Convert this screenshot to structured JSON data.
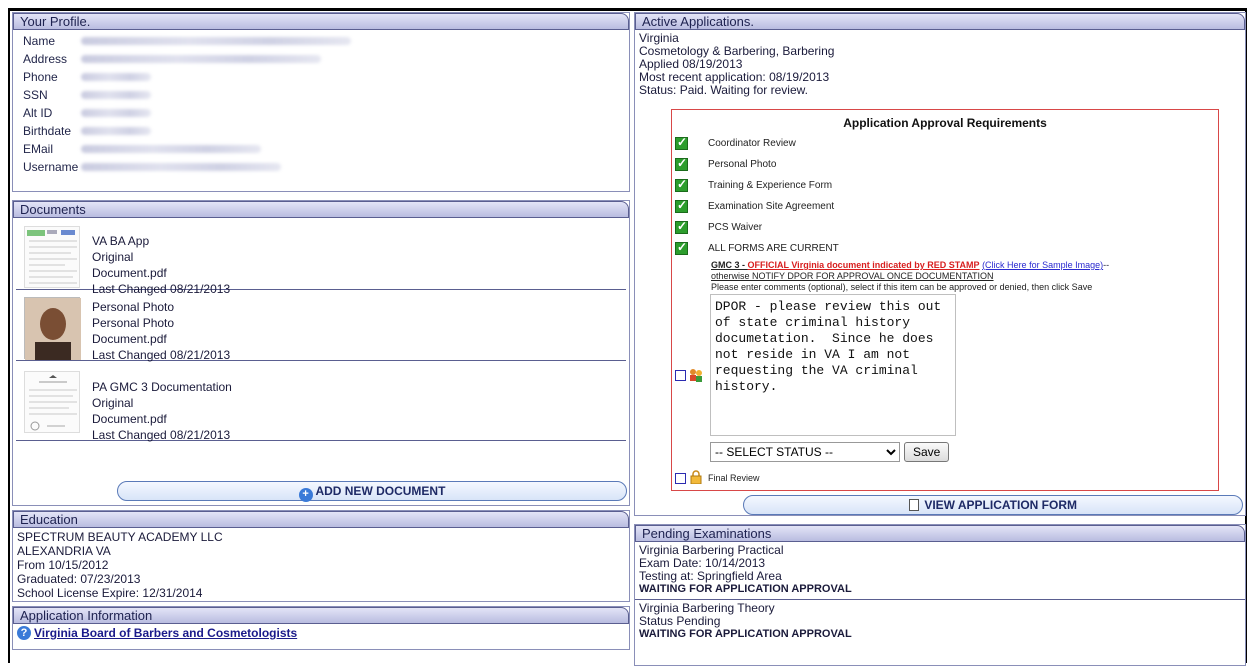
{
  "profile": {
    "title": "Your Profile.",
    "fields": [
      {
        "label": "Name"
      },
      {
        "label": "Address"
      },
      {
        "label": "Phone"
      },
      {
        "label": "SSN"
      },
      {
        "label": "Alt ID"
      },
      {
        "label": "Birthdate"
      },
      {
        "label": "EMail"
      },
      {
        "label": "Username"
      }
    ]
  },
  "documents": {
    "title": "Documents",
    "items": [
      {
        "name": "VA BA App",
        "type": "Original",
        "file": "Document.pdf",
        "changed": "Last Changed 08/21/2013"
      },
      {
        "name": "Personal Photo",
        "type": "Personal Photo",
        "file": "Document.pdf",
        "changed": "Last Changed 08/21/2013"
      },
      {
        "name": "PA GMC 3 Documentation",
        "type": "Original",
        "file": "Document.pdf",
        "changed": "Last Changed 08/21/2013"
      }
    ],
    "add_button": "ADD NEW DOCUMENT"
  },
  "education": {
    "title": "Education",
    "lines": [
      "SPECTRUM BEAUTY ACADEMY LLC",
      "ALEXANDRIA VA",
      "From 10/15/2012",
      "Graduated: 07/23/2013",
      "School License Expire: 12/31/2014"
    ]
  },
  "app_info": {
    "title": "Application Information",
    "link": "Virginia Board of Barbers and Cosmetologists"
  },
  "active": {
    "title": "Active Applications.",
    "lines": [
      "Virginia",
      "Cosmetology & Barbering, Barbering",
      "Applied 08/19/2013",
      "Most recent application: 08/19/2013",
      "Status: Paid. Waiting for review."
    ],
    "requirements": {
      "title": "Application Approval Requirements",
      "items": [
        "Coordinator Review",
        "Personal Photo",
        "Training & Experience Form",
        "Examination Site Agreement",
        "PCS Waiver",
        "ALL FORMS ARE CURRENT"
      ],
      "gmc_prefix": "GMC 3 - ",
      "gmc_red": "OFFICIAL Virginia document indicated by RED STAMP",
      "gmc_link": "(Click Here for Sample Image)",
      "gmc_suffix": "--",
      "gmc_line2": "otherwise NOTIFY DPOR FOR APPROVAL ONCE DOCUMENTATION",
      "instructions": "Please enter comments (optional), select if this item can be approved or denied, then click Save",
      "comment": "DPOR - please review this out\nof state criminal history\ndocumetation.  Since he does\nnot reside in VA I am not\nrequesting the VA criminal\nhistory.",
      "status_select": "-- SELECT STATUS --",
      "save": "Save",
      "final_review": "Final Review"
    },
    "view_button": "VIEW APPLICATION FORM"
  },
  "pending": {
    "title": "Pending Examinations",
    "exams": [
      {
        "name": "Virginia Barbering Practical",
        "line2": "Exam Date: 10/14/2013",
        "line3": "Testing at: Springfield Area",
        "status": "WAITING FOR APPLICATION APPROVAL"
      },
      {
        "name": "Virginia Barbering Theory",
        "line2": "Status Pending",
        "status": "WAITING FOR APPLICATION APPROVAL"
      }
    ]
  }
}
